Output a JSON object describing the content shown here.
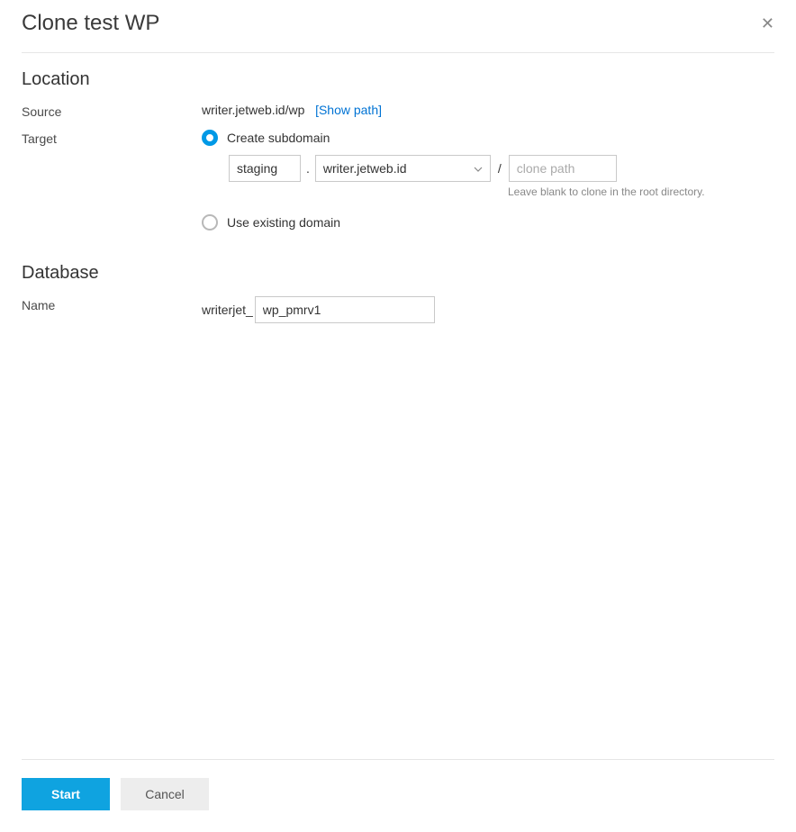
{
  "title": "Clone test WP",
  "location": {
    "heading": "Location",
    "source_label": "Source",
    "source_value": "writer.jetweb.id/wp",
    "show_path_link": "[Show path]",
    "target_label": "Target",
    "create_subdomain_label": "Create subdomain",
    "subdomain_value": "staging",
    "domain_select_value": "writer.jetweb.id",
    "path_placeholder": "clone path",
    "path_hint": "Leave blank to clone in the root directory.",
    "existing_domain_label": "Use existing domain"
  },
  "database": {
    "heading": "Database",
    "name_label": "Name",
    "prefix": "writerjet_",
    "name_value": "wp_pmrv1"
  },
  "actions": {
    "start": "Start",
    "cancel": "Cancel"
  }
}
